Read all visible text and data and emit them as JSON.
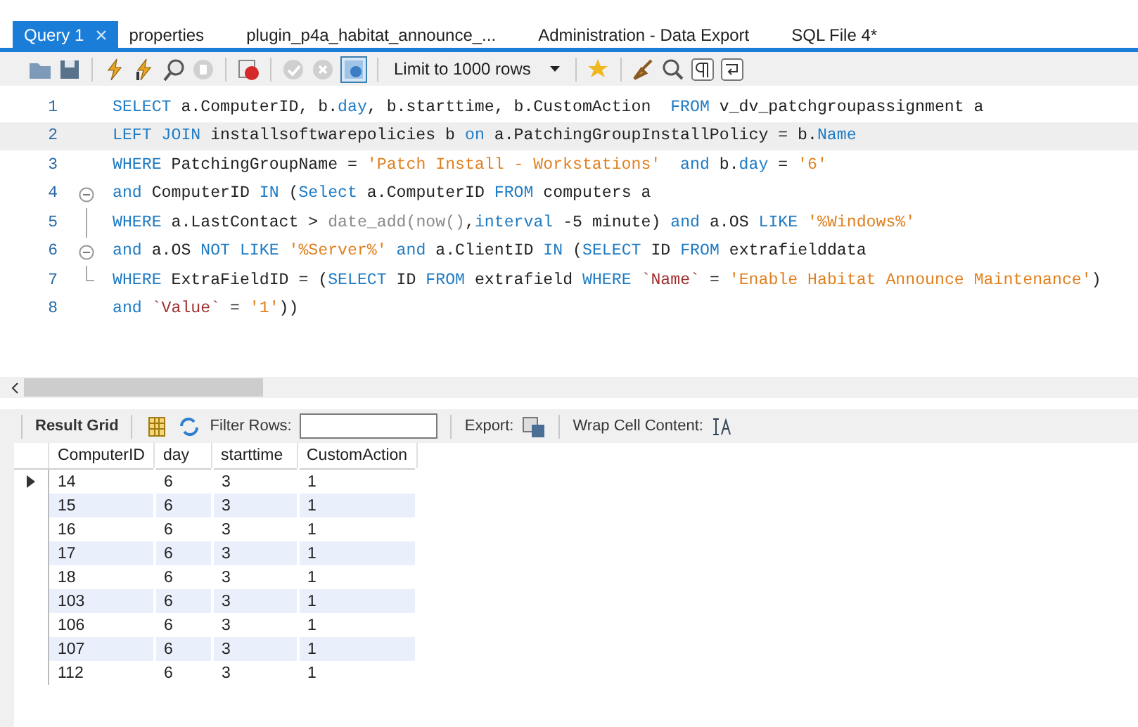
{
  "tabs": [
    {
      "label": "Query 1",
      "selected": true,
      "closable": true
    },
    {
      "label": "properties",
      "selected": false,
      "closable": false
    },
    {
      "label": "plugin_p4a_habitat_announce_...",
      "selected": false,
      "closable": false
    },
    {
      "label": "Administration - Data Export",
      "selected": false,
      "closable": false
    },
    {
      "label": "SQL File 4*",
      "selected": false,
      "closable": false
    }
  ],
  "toolbar": {
    "transaction_buttons_disabled": true,
    "autocommit_on": true,
    "limit": "Limit to 1000 rows"
  },
  "editor": {
    "lines": [
      {
        "number": "1",
        "selected": false,
        "fold_start": false,
        "fold_guide": false,
        "fold_end": false,
        "tokens": [
          {
            "kind": "keyword",
            "text": "SELECT"
          },
          {
            "kind": "plain",
            "text": " a.ComputerID, b."
          },
          {
            "kind": "keyword",
            "text": "day"
          },
          {
            "kind": "plain",
            "text": ", b.starttime, b.CustomAction  "
          },
          {
            "kind": "keyword",
            "text": "FROM"
          },
          {
            "kind": "plain",
            "text": " v_dv_patchgroupassignment a"
          }
        ]
      },
      {
        "number": "2",
        "selected": true,
        "fold_start": false,
        "fold_guide": false,
        "fold_end": false,
        "tokens": [
          {
            "kind": "keyword",
            "text": "LEFT JOIN"
          },
          {
            "kind": "plain",
            "text": " installsoftwarepolicies b "
          },
          {
            "kind": "keyword",
            "text": "on"
          },
          {
            "kind": "plain",
            "text": " a.PatchingGroupInstallPolicy = b."
          },
          {
            "kind": "keyword",
            "text": "Name"
          }
        ]
      },
      {
        "number": "3",
        "selected": false,
        "fold_start": false,
        "fold_guide": false,
        "fold_end": false,
        "tokens": [
          {
            "kind": "keyword",
            "text": "WHERE"
          },
          {
            "kind": "plain",
            "text": " PatchingGroupName = "
          },
          {
            "kind": "string",
            "text": "'Patch Install - Workstations'  "
          },
          {
            "kind": "keyword",
            "text": "and"
          },
          {
            "kind": "plain",
            "text": " b."
          },
          {
            "kind": "keyword",
            "text": "day"
          },
          {
            "kind": "plain",
            "text": " = "
          },
          {
            "kind": "string",
            "text": "'6'"
          }
        ]
      },
      {
        "number": "4",
        "selected": false,
        "fold_start": true,
        "fold_guide": false,
        "fold_end": false,
        "tokens": [
          {
            "kind": "keyword",
            "text": "and"
          },
          {
            "kind": "plain",
            "text": " ComputerID "
          },
          {
            "kind": "keyword",
            "text": "IN"
          },
          {
            "kind": "plain",
            "text": " ("
          },
          {
            "kind": "keyword",
            "text": "Select"
          },
          {
            "kind": "plain",
            "text": " a.ComputerID "
          },
          {
            "kind": "keyword",
            "text": "FROM"
          },
          {
            "kind": "plain",
            "text": " computers a"
          }
        ]
      },
      {
        "number": "5",
        "selected": false,
        "fold_start": false,
        "fold_guide": true,
        "fold_end": false,
        "tokens": [
          {
            "kind": "keyword",
            "text": "WHERE"
          },
          {
            "kind": "plain",
            "text": " a.LastContact > "
          },
          {
            "kind": "function",
            "text": "date_add(now()"
          },
          {
            "kind": "plain",
            "text": ","
          },
          {
            "kind": "keyword",
            "text": "interval"
          },
          {
            "kind": "plain",
            "text": " -5 minute) "
          },
          {
            "kind": "keyword",
            "text": "and"
          },
          {
            "kind": "plain",
            "text": " a.OS "
          },
          {
            "kind": "keyword",
            "text": "LIKE "
          },
          {
            "kind": "string",
            "text": "'%Windows%'"
          }
        ]
      },
      {
        "number": "6",
        "selected": false,
        "fold_start": true,
        "fold_guide": false,
        "fold_end": false,
        "tokens": [
          {
            "kind": "keyword",
            "text": "and"
          },
          {
            "kind": "plain",
            "text": " a.OS "
          },
          {
            "kind": "keyword",
            "text": "NOT LIKE "
          },
          {
            "kind": "string",
            "text": "'%Server%' "
          },
          {
            "kind": "keyword",
            "text": "and"
          },
          {
            "kind": "plain",
            "text": " a.ClientID "
          },
          {
            "kind": "keyword",
            "text": "IN"
          },
          {
            "kind": "plain",
            "text": " ("
          },
          {
            "kind": "keyword",
            "text": "SELECT"
          },
          {
            "kind": "plain",
            "text": " ID "
          },
          {
            "kind": "keyword",
            "text": "FROM"
          },
          {
            "kind": "plain",
            "text": " extrafielddata"
          }
        ]
      },
      {
        "number": "7",
        "selected": false,
        "fold_start": false,
        "fold_guide": false,
        "fold_end": true,
        "tokens": [
          {
            "kind": "keyword",
            "text": "WHERE"
          },
          {
            "kind": "plain",
            "text": " ExtraFieldID = ("
          },
          {
            "kind": "keyword",
            "text": "SELECT"
          },
          {
            "kind": "plain",
            "text": " ID "
          },
          {
            "kind": "keyword",
            "text": "FROM"
          },
          {
            "kind": "plain",
            "text": " extrafield "
          },
          {
            "kind": "keyword",
            "text": "WHERE "
          },
          {
            "kind": "identifier",
            "text": "`Name`"
          },
          {
            "kind": "plain",
            "text": " = "
          },
          {
            "kind": "string",
            "text": "'Enable Habitat Announce Maintenance'"
          },
          {
            "kind": "plain",
            "text": ")"
          }
        ]
      },
      {
        "number": "8",
        "selected": false,
        "fold_start": false,
        "fold_guide": false,
        "fold_end": false,
        "tokens": [
          {
            "kind": "keyword",
            "text": "and "
          },
          {
            "kind": "identifier",
            "text": "`Value`"
          },
          {
            "kind": "plain",
            "text": " = "
          },
          {
            "kind": "string",
            "text": "'1'"
          },
          {
            "kind": "plain",
            "text": "))"
          }
        ]
      }
    ]
  },
  "result_toolbar": {
    "title": "Result Grid",
    "filter_label": "Filter Rows:",
    "export_label": "Export:",
    "wrap_label": "Wrap Cell Content:"
  },
  "table": {
    "columns": [
      "ComputerID",
      "day",
      "starttime",
      "CustomAction"
    ],
    "rows": [
      {
        "selected": true,
        "cells": [
          "14",
          "6",
          "3",
          "1"
        ]
      },
      {
        "selected": false,
        "cells": [
          "15",
          "6",
          "3",
          "1"
        ]
      },
      {
        "selected": false,
        "cells": [
          "16",
          "6",
          "3",
          "1"
        ]
      },
      {
        "selected": false,
        "cells": [
          "17",
          "6",
          "3",
          "1"
        ]
      },
      {
        "selected": false,
        "cells": [
          "18",
          "6",
          "3",
          "1"
        ]
      },
      {
        "selected": false,
        "cells": [
          "103",
          "6",
          "3",
          "1"
        ]
      },
      {
        "selected": false,
        "cells": [
          "106",
          "6",
          "3",
          "1"
        ]
      },
      {
        "selected": false,
        "cells": [
          "107",
          "6",
          "3",
          "1"
        ]
      },
      {
        "selected": false,
        "cells": [
          "112",
          "6",
          "3",
          "1"
        ]
      }
    ]
  }
}
